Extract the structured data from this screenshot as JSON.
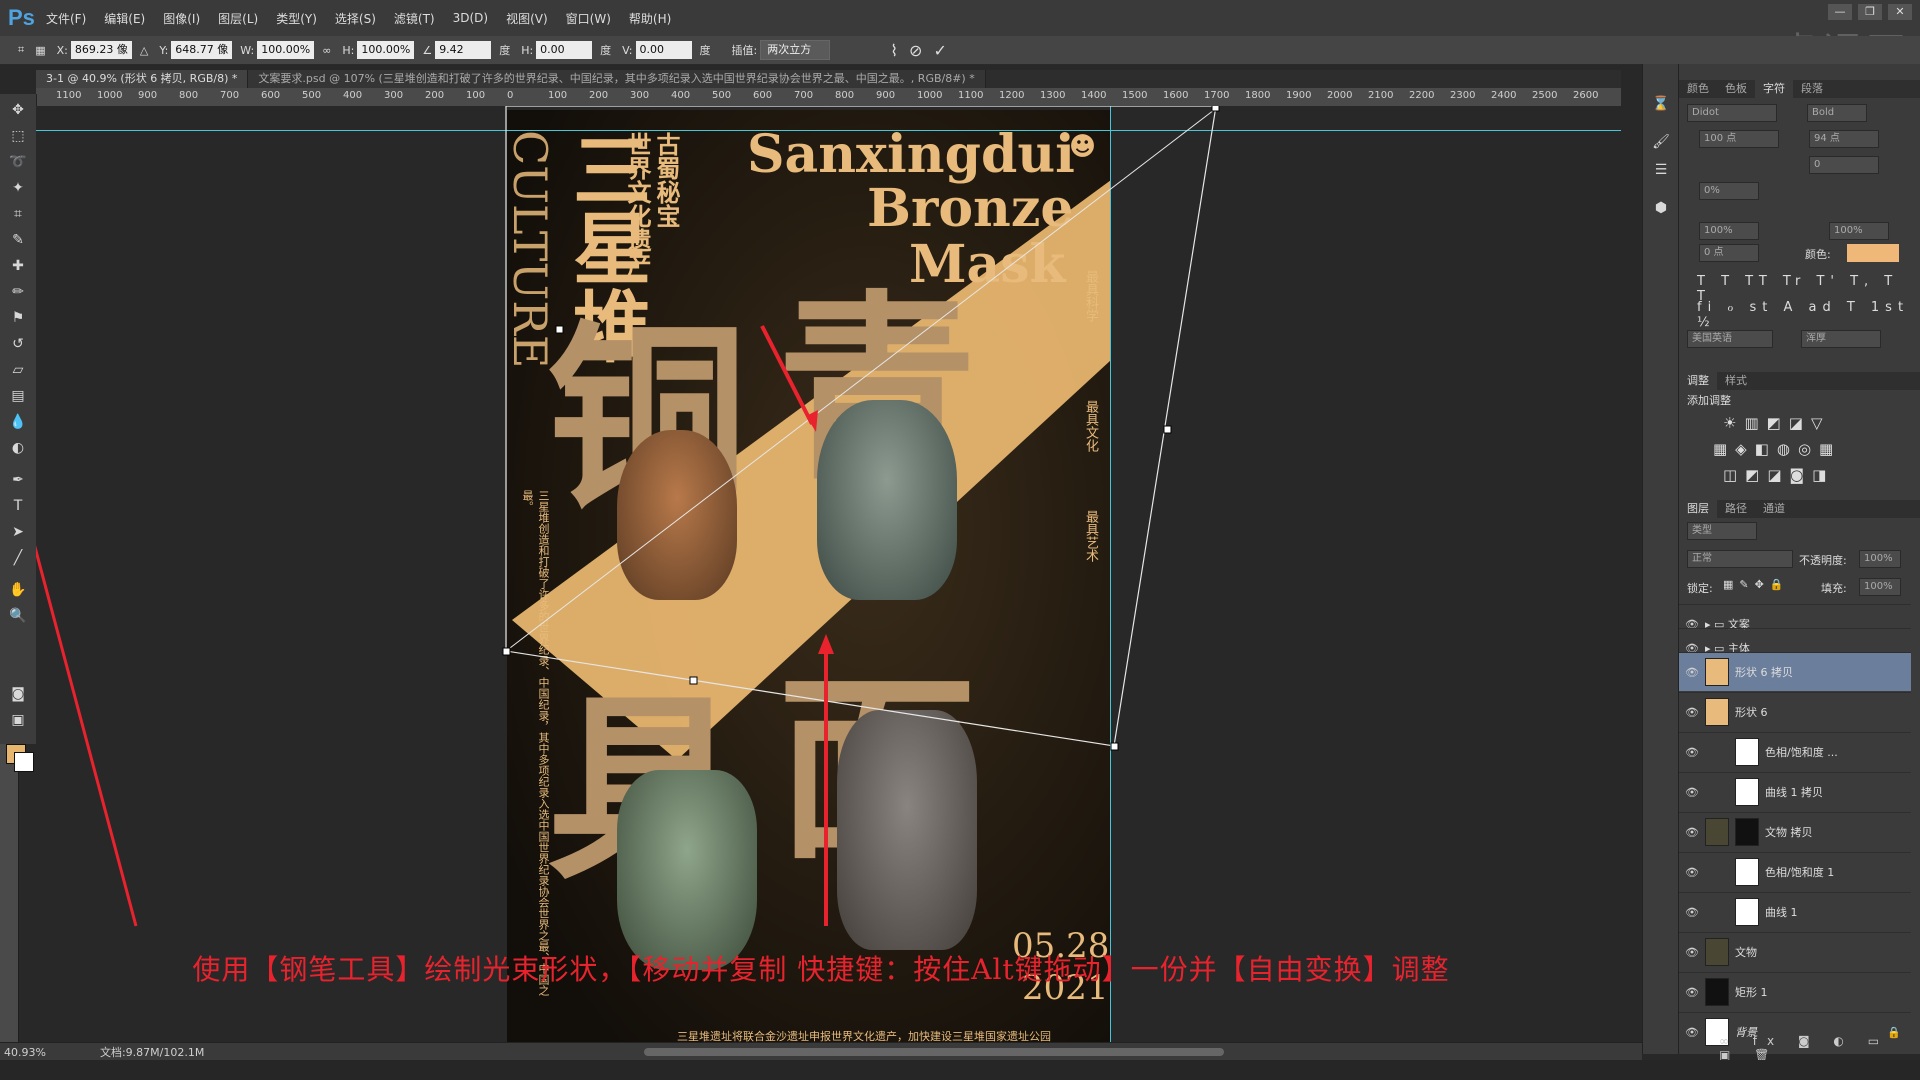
{
  "app": {
    "logo": "Ps",
    "menus": [
      "文件(F)",
      "编辑(E)",
      "图像(I)",
      "图层(L)",
      "类型(Y)",
      "选择(S)",
      "滤镜(T)",
      "3D(D)",
      "视图(V)",
      "窗口(W)",
      "帮助(H)"
    ],
    "window_buttons": [
      "—",
      "❐",
      "✕"
    ],
    "watermark": "虎课网"
  },
  "options": {
    "x_label": "X:",
    "x_value": "869.23 像",
    "y_label": "Y:",
    "y_value": "648.77 像",
    "w_label": "W:",
    "w_value": "100.00%",
    "h_label": "H:",
    "h_value": "100.00%",
    "angle_value": "9.42",
    "angle_unit": "度",
    "hskew_label": "H:",
    "hskew_value": "0.00",
    "hskew_unit": "度",
    "vskew_label": "V:",
    "vskew_value": "0.00",
    "vskew_unit": "度",
    "interp_label": "插值:",
    "interp_value": "两次立方"
  },
  "tabs": [
    "3-1 @ 40.9% (形状 6 拷贝, RGB/8) *",
    "文案要求.psd @ 107% (三星堆创造和打破了许多的世界纪录、中国纪录，其中多项纪录入选中国世界纪录协会世界之最、中国之最。, RGB/8#) *"
  ],
  "ruler_ticks": [
    "1100",
    "1000",
    "900",
    "800",
    "700",
    "600",
    "500",
    "400",
    "300",
    "200",
    "100",
    "0",
    "100",
    "200",
    "300",
    "400",
    "500",
    "600",
    "700",
    "800",
    "900",
    "1000",
    "1100",
    "1200",
    "1300",
    "1400",
    "1500",
    "1600",
    "1700",
    "1800",
    "1900",
    "2000",
    "2100",
    "2200",
    "2300",
    "2400",
    "2500",
    "2600"
  ],
  "poster": {
    "vertical_title": "三星堆",
    "subtitle_vertical_1": "古蜀秘宝",
    "subtitle_vertical_2": "世界文化遗产",
    "en_line1": "Sanxingdui",
    "en_line2": "Bronze",
    "en_line3": "Mask",
    "left_en": "CULTURE",
    "big_1": "铜",
    "big_2": "青",
    "big_3": "具",
    "big_4": "面",
    "right_col_1": "最具科学",
    "right_col_2": "最具文化",
    "right_col_3": "最具艺术",
    "date": "05.28",
    "year": "2021",
    "footer": "三星堆遗址将联合金沙遗址申报世界文化遗产，加快建设三星堆国家遗址公园",
    "left_small": "三星堆创造和打破了许多的世界纪录、中国纪录，其中多项纪录入选中国世界纪录协会世界之最、中国之最。"
  },
  "panels": {
    "char_tabs": [
      "颜色",
      "色板",
      "字符",
      "段落"
    ],
    "font_family": "Didot",
    "font_style": "Bold",
    "font_size": "100 点",
    "leading": "94 点",
    "tracking": "0",
    "scale_pct": "0%",
    "vscale": "100%",
    "hscale": "100%",
    "baseline": "0 点",
    "color_label": "颜色:",
    "language": "美国英语",
    "aa": "浑厚",
    "adj_tabs": [
      "调整",
      "样式"
    ],
    "adj_title": "添加调整",
    "layer_tabs": [
      "图层",
      "路径",
      "通道"
    ],
    "kind": "类型",
    "blend": "正常",
    "opacity_label": "不透明度:",
    "opacity": "100%",
    "lock_label": "锁定:",
    "fill_label": "填充:",
    "fill": "100%",
    "layers": [
      {
        "name": "文案",
        "type": "group"
      },
      {
        "name": "主体",
        "type": "group"
      },
      {
        "name": "形状 6 拷贝",
        "type": "shape",
        "selected": true
      },
      {
        "name": "形状 6",
        "type": "shape"
      },
      {
        "name": "色相/饱和度 ...",
        "type": "adj"
      },
      {
        "name": "曲线 1 拷贝",
        "type": "adj"
      },
      {
        "name": "文物 拷贝",
        "type": "image"
      },
      {
        "name": "色相/饱和度 1",
        "type": "adj"
      },
      {
        "name": "曲线 1",
        "type": "adj"
      },
      {
        "name": "文物",
        "type": "image"
      },
      {
        "name": "矩形 1",
        "type": "shape"
      },
      {
        "name": "背景",
        "type": "bg"
      }
    ]
  },
  "status": {
    "zoom": "40.93%",
    "doc": "文档:9.87M/102.1M"
  },
  "subtitle": "使用【钢笔工具】绘制光束形状，【移动并复制 快捷键：按住Alt键拖动】一份并【自由变换】调整",
  "colors": {
    "accent_gold": "#e8bb7c",
    "subtitle_red": "#e8232e",
    "guide_cyan": "#46c6d6"
  }
}
